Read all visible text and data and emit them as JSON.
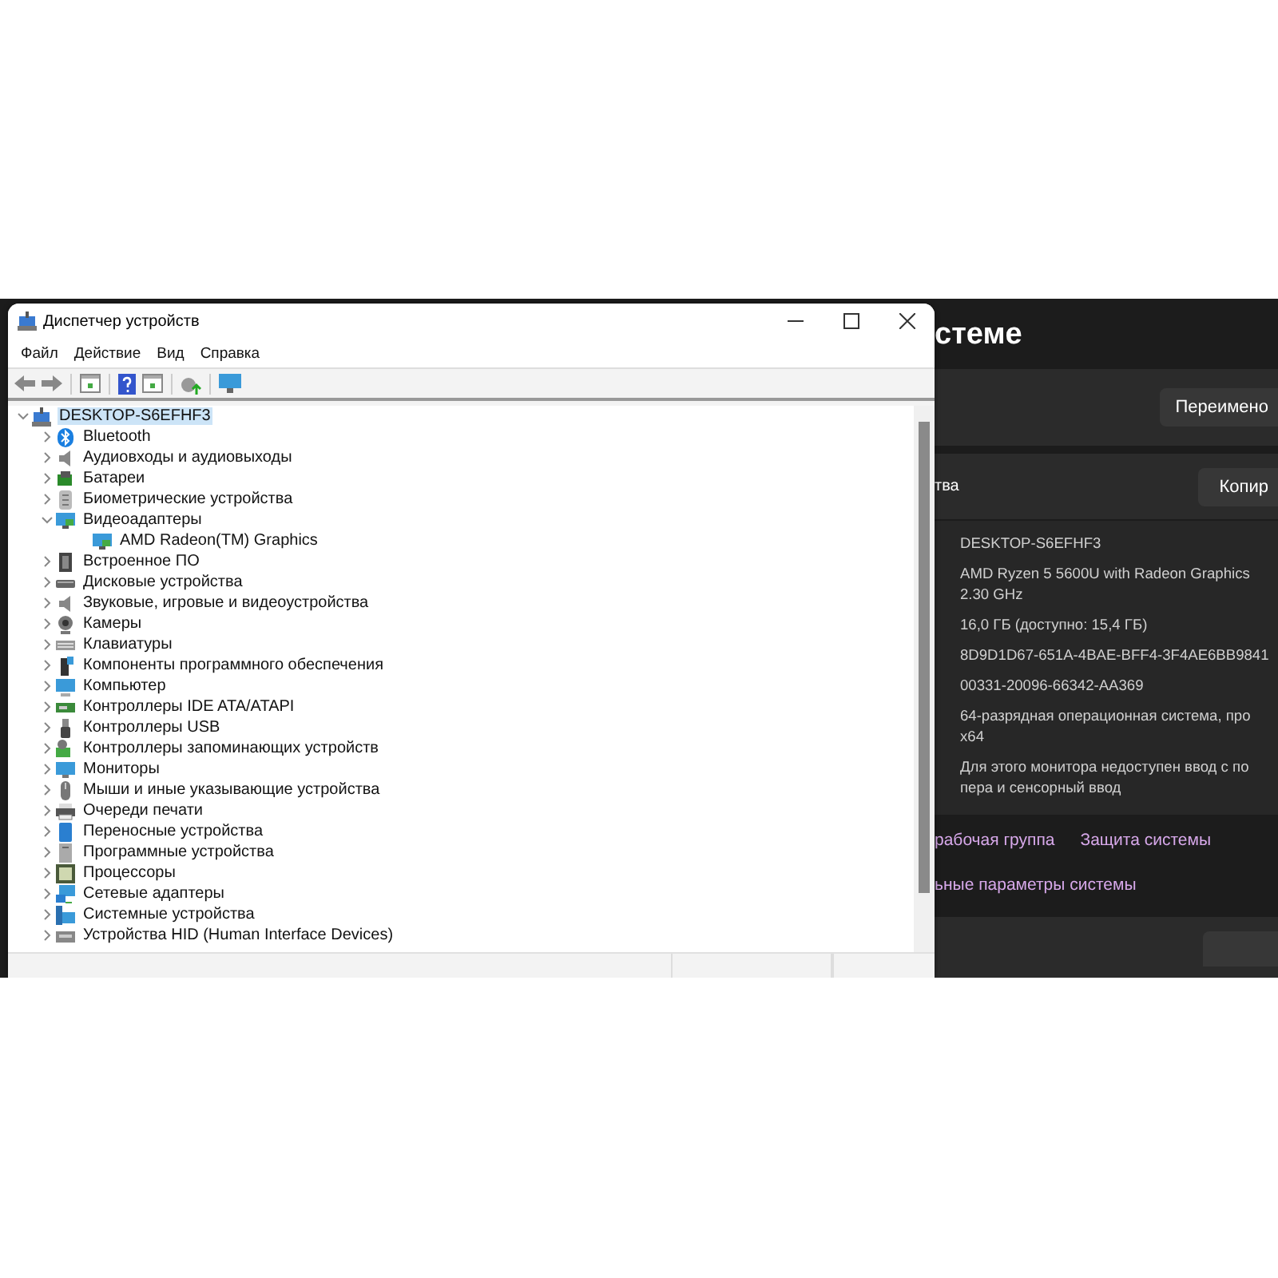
{
  "device_manager": {
    "title": "Диспетчер устройств",
    "menu": [
      "Файл",
      "Действие",
      "Вид",
      "Справка"
    ],
    "tree": {
      "label": "DESKTOP-S6EFHF3",
      "expanded": true,
      "children": [
        {
          "label": "Bluetooth",
          "expanded": false
        },
        {
          "label": "Аудиовходы и аудиовыходы",
          "expanded": false
        },
        {
          "label": "Батареи",
          "expanded": false
        },
        {
          "label": "Биометрические устройства",
          "expanded": false
        },
        {
          "label": "Видеоадаптеры",
          "expanded": true,
          "children": [
            {
              "label": "AMD Radeon(TM) Graphics"
            }
          ]
        },
        {
          "label": "Встроенное ПО",
          "expanded": false
        },
        {
          "label": "Дисковые устройства",
          "expanded": false
        },
        {
          "label": "Звуковые, игровые и видеоустройства",
          "expanded": false
        },
        {
          "label": "Камеры",
          "expanded": false
        },
        {
          "label": "Клавиатуры",
          "expanded": false
        },
        {
          "label": "Компоненты программного обеспечения",
          "expanded": false
        },
        {
          "label": "Компьютер",
          "expanded": false
        },
        {
          "label": "Контроллеры IDE ATA/ATAPI",
          "expanded": false
        },
        {
          "label": "Контроллеры USB",
          "expanded": false
        },
        {
          "label": "Контроллеры запоминающих устройств",
          "expanded": false
        },
        {
          "label": "Мониторы",
          "expanded": false
        },
        {
          "label": "Мыши и иные указывающие устройства",
          "expanded": false
        },
        {
          "label": "Очереди печати",
          "expanded": false
        },
        {
          "label": "Переносные устройства",
          "expanded": false
        },
        {
          "label": "Программные устройства",
          "expanded": false
        },
        {
          "label": "Процессоры",
          "expanded": false
        },
        {
          "label": "Сетевые адаптеры",
          "expanded": false
        },
        {
          "label": "Системные устройства",
          "expanded": false
        },
        {
          "label": "Устройства HID (Human Interface Devices)",
          "expanded": false
        }
      ]
    }
  },
  "settings": {
    "title": "стеме",
    "rename_button": "Переимено",
    "specs_label": "тва",
    "copy_button": "Копир",
    "specs": [
      "DESKTOP-S6EFHF3",
      "AMD Ryzen 5 5600U with Radeon Graphics\n2.30 GHz",
      "16,0 ГБ (доступно: 15,4 ГБ)",
      "8D9D1D67-651A-4BAE-BFF4-3F4AE6BB9841",
      "00331-20096-66342-AA369",
      "64-разрядная операционная система, про\nx64",
      "Для этого монитора недоступен ввод с по\nпера и сенсорный ввод"
    ],
    "links": [
      [
        "рабочая группа",
        "Защита системы"
      ],
      [
        "ьные параметры системы"
      ]
    ]
  }
}
